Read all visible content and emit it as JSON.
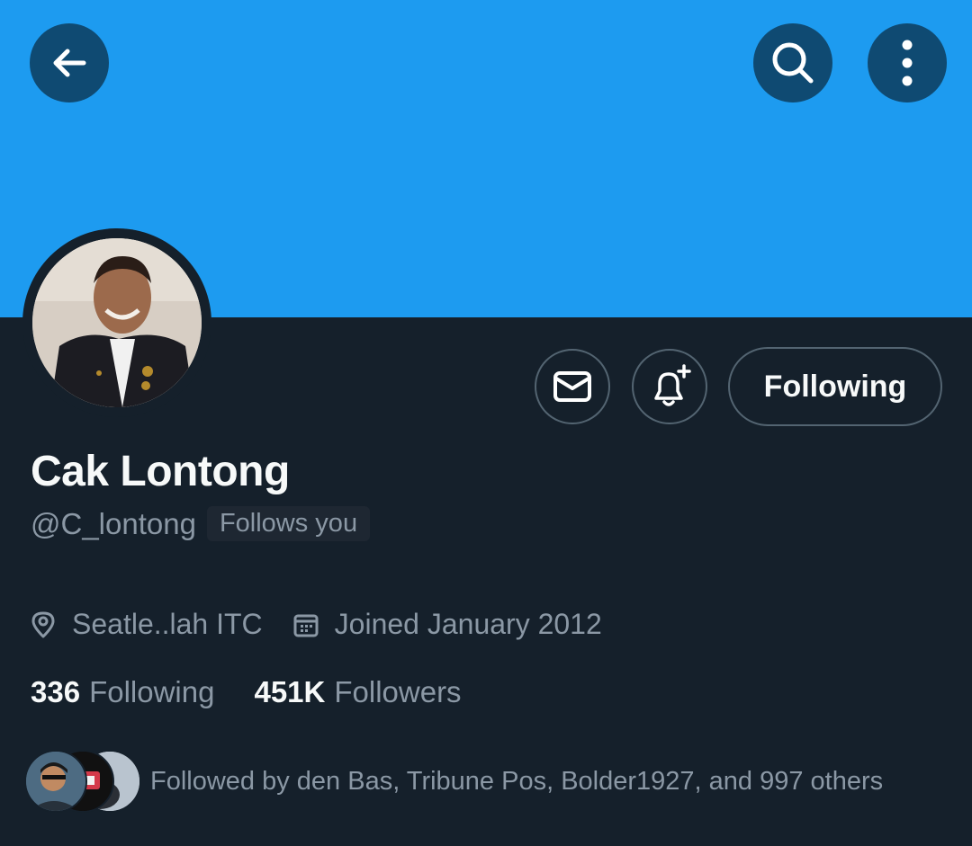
{
  "header": {
    "back_icon": "arrow-left-icon",
    "search_icon": "search-icon",
    "more_icon": "more-vertical-icon"
  },
  "colors": {
    "banner": "#1d9bf0",
    "background": "#15202b",
    "secondary_text": "#8b98a5",
    "border": "#536471"
  },
  "profile": {
    "name": "Cak Lontong",
    "handle": "@C_lontong",
    "follows_you": "Follows you",
    "location": "Seatle..lah ITC",
    "joined": "Joined January 2012"
  },
  "actions": {
    "message_icon": "envelope-icon",
    "notify_icon": "bell-plus-icon",
    "following_label": "Following"
  },
  "stats": {
    "following_count": "336",
    "following_label": "Following",
    "followers_count": "451K",
    "followers_label": "Followers"
  },
  "followed_by": {
    "text": "Followed by den Bas, Tribune Pos, Bolder1927, and 997 others"
  }
}
